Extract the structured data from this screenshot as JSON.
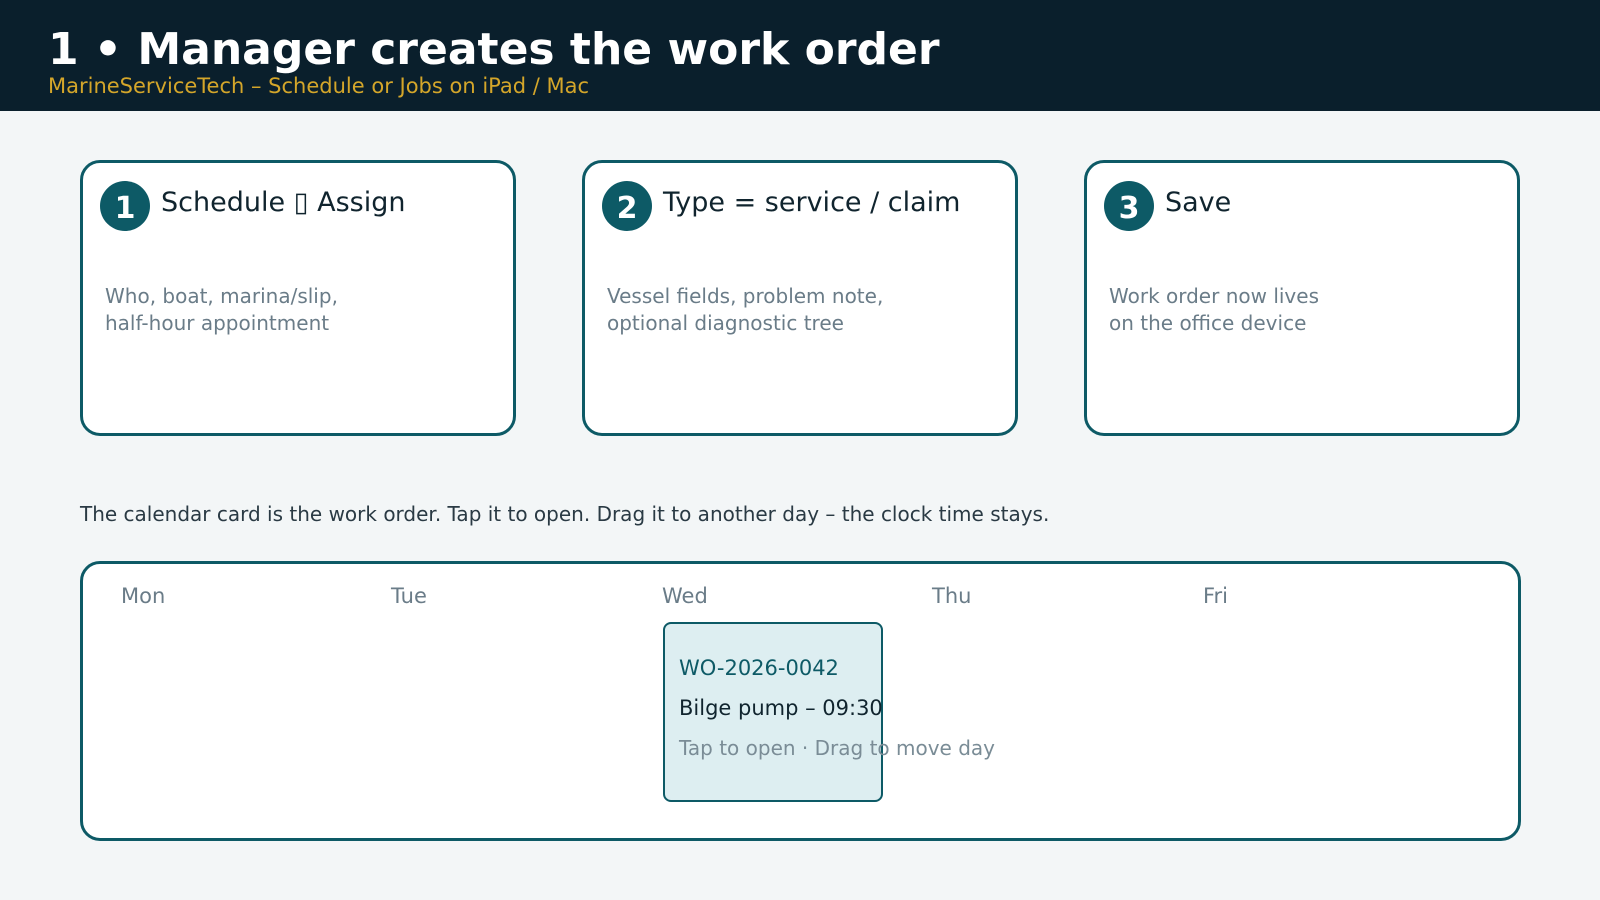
{
  "header": {
    "title": "1 • Manager creates the work order",
    "subtitle": "MarineServiceTech – Schedule or Jobs on iPad / Mac"
  },
  "steps": [
    {
      "number": "1",
      "title": "Schedule ▯ Assign",
      "description": "Who, boat, marina/slip,\nhalf-hour appointment"
    },
    {
      "number": "2",
      "title": "Type = service / claim",
      "description": "Vessel fields, problem note,\noptional diagnostic tree"
    },
    {
      "number": "3",
      "title": "Save",
      "description": "Work order now lives\non the office device"
    }
  ],
  "caption": "The calendar card is the work order. Tap it to open. Drag it to another day – the clock time stays.",
  "calendar": {
    "days": [
      "Mon",
      "Tue",
      "Wed",
      "Thu",
      "Fri"
    ],
    "event": {
      "id": "WO-2026-0042",
      "title": "Bilge pump – 09:30",
      "hint": "Tap to open  ·  Drag to move day"
    }
  },
  "colors": {
    "header_bg": "#0a1f2c",
    "accent": "#0d5a66",
    "subtitle": "#d4a62a",
    "event_bg": "#ddeef1"
  }
}
